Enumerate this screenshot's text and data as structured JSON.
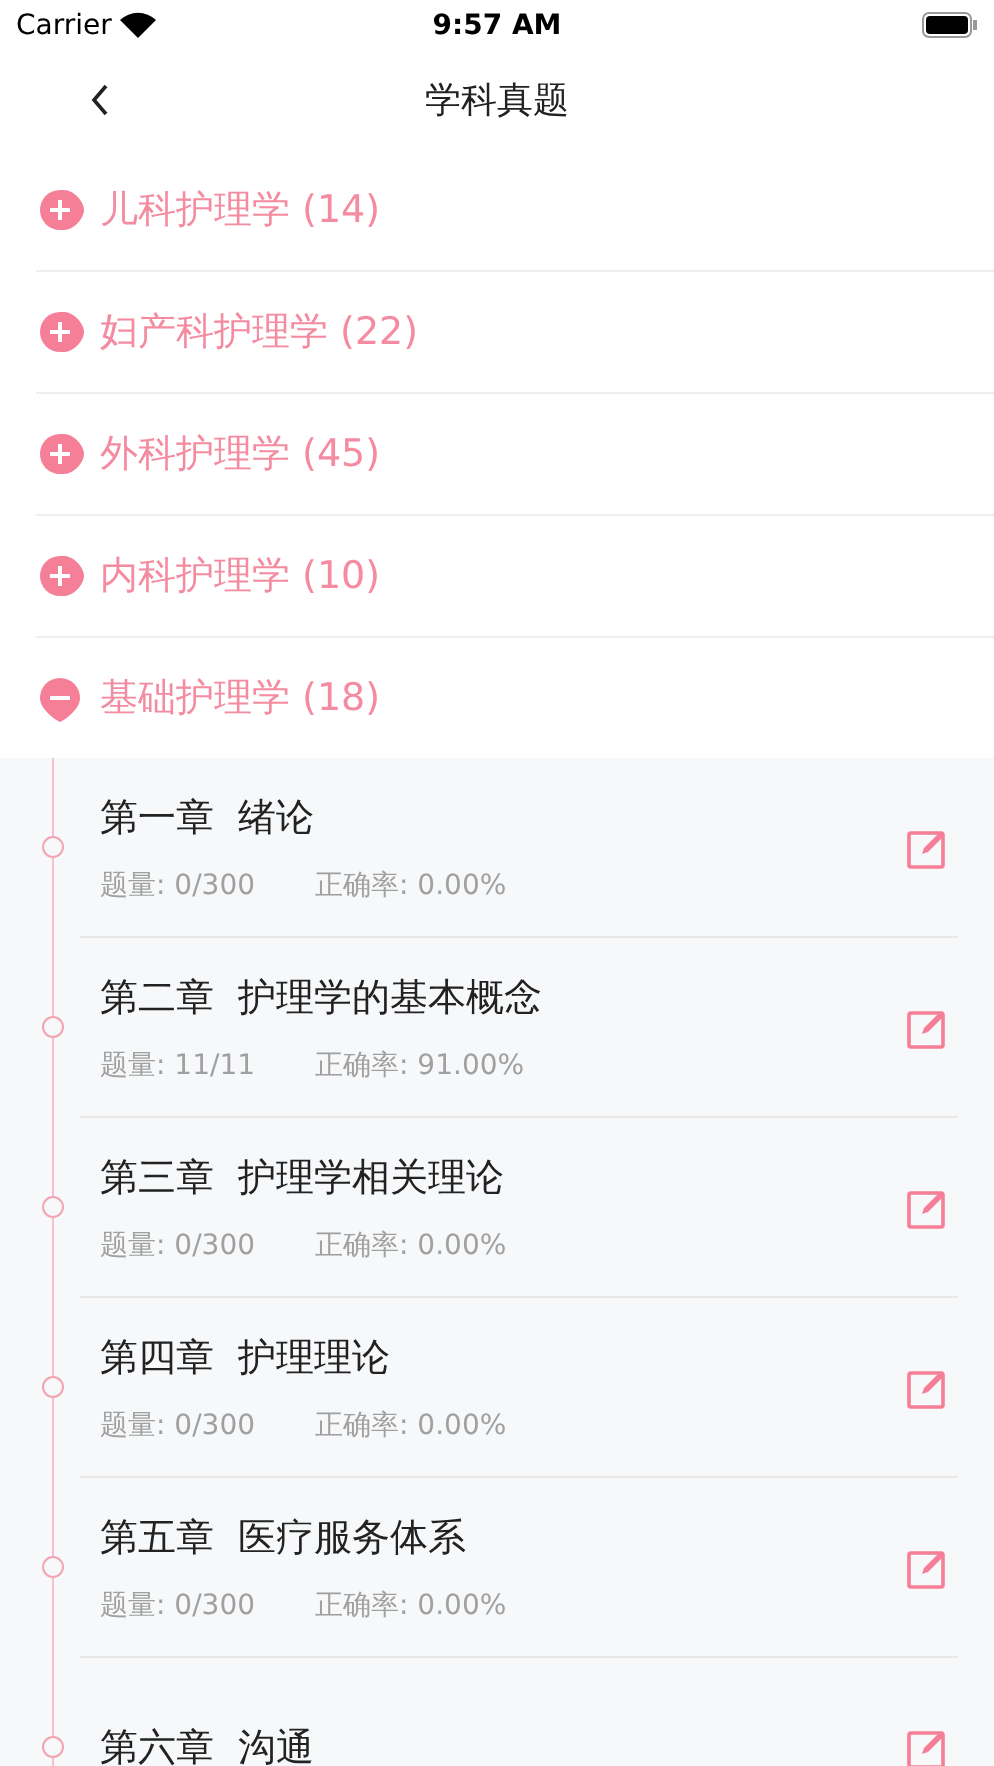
{
  "status_bar": {
    "carrier": "Carrier",
    "time": "9:57 AM"
  },
  "nav": {
    "title": "学科真题"
  },
  "categories": [
    {
      "label": "儿科护理学 (14)",
      "expanded": false
    },
    {
      "label": "妇产科护理学 (22)",
      "expanded": false
    },
    {
      "label": "外科护理学 (45)",
      "expanded": false
    },
    {
      "label": "内科护理学 (10)",
      "expanded": false
    },
    {
      "label": "基础护理学 (18)",
      "expanded": true,
      "chapters": [
        {
          "title": "第一章  绪论",
          "count": "题量: 0/300",
          "accuracy": "正确率: 0.00%"
        },
        {
          "title": "第二章  护理学的基本概念",
          "count": "题量: 11/11",
          "accuracy": "正确率: 91.00%"
        },
        {
          "title": "第三章  护理学相关理论",
          "count": "题量: 0/300",
          "accuracy": "正确率: 0.00%"
        },
        {
          "title": "第四章  护理理论",
          "count": "题量: 0/300",
          "accuracy": "正确率: 0.00%"
        },
        {
          "title": "第五章  医疗服务体系",
          "count": "题量: 0/300",
          "accuracy": "正确率: 0.00%"
        },
        {
          "title": "第六章  沟通"
        }
      ]
    }
  ]
}
